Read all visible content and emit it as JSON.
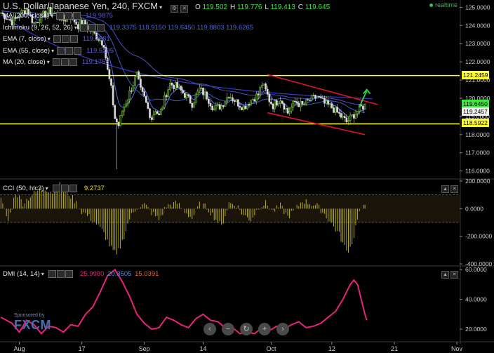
{
  "header": {
    "title": "U.S. Dollar/Japanese Yen, 240, FXCM",
    "ohlc": [
      {
        "k": "O",
        "v": "119.502"
      },
      {
        "k": "H",
        "v": "119.776"
      },
      {
        "k": "L",
        "v": "119.413"
      },
      {
        "k": "C",
        "v": "119.645"
      }
    ],
    "realtime": "realtime"
  },
  "indicators": [
    {
      "label": "MA (200, close)",
      "value": "119.9875",
      "color": "#5a5cd6"
    },
    {
      "label": "Ichimoku (9, 26, 52, 26)",
      "value": "119.3375  118.9150  119.6450  119.8803  119.6265",
      "color": "#4a6ad8"
    },
    {
      "label": "EMA (7, close)",
      "value": "119.3681",
      "color": "#5a5cd6"
    },
    {
      "label": "EMA (55, close)",
      "value": "119.5295",
      "color": "#5a5cd6"
    },
    {
      "label": "MA (20, close)",
      "value": "119.1758",
      "color": "#5a5cd6"
    }
  ],
  "cci_panel": {
    "label": "CCI (50, hlc3)",
    "value": "9.2737",
    "value_color": "#e8e020"
  },
  "dmi_panel": {
    "label": "DMI (14, 14)",
    "values": [
      "25.9980",
      "20.3505",
      "15.0391"
    ],
    "colors": [
      "#e8237a",
      "#4a8ce8",
      "#e86a23"
    ]
  },
  "sponsor": {
    "line1": "Sponsored by",
    "line2": "FXCM"
  },
  "price_tags": [
    {
      "text": "121.2459",
      "value": 121.2459,
      "bg": "#ffff30"
    },
    {
      "text": "119.6450",
      "value": 119.645,
      "bg": "#42e642"
    },
    {
      "text": "119.2457",
      "value": 119.2457,
      "bg": "#f0f0f0"
    },
    {
      "text": "118.5922",
      "value": 118.5922,
      "bg": "#ffff30"
    }
  ],
  "chart_data": [
    {
      "type": "candlestick",
      "series_name": "USD/JPY 240",
      "ylim": [
        115.6,
        125.4
      ],
      "y_ticks": [
        "125.0000",
        "124.0000",
        "123.0000",
        "122.0000",
        "121.0000",
        "120.0000",
        "119.0000",
        "118.0000",
        "117.0000",
        "116.0000"
      ],
      "y_tick_values": [
        125,
        124,
        123,
        122,
        121,
        120,
        119,
        118,
        117,
        116
      ],
      "x_ticks": [
        "Aug",
        "17",
        "Sep",
        "14",
        "Oct",
        "12",
        "21",
        "Nov"
      ],
      "x_tick_index": [
        10,
        44,
        78,
        110,
        147,
        180,
        214,
        248
      ],
      "n_bars": 250,
      "close_path": [
        [
          0,
          124.7
        ],
        [
          6,
          124.2
        ],
        [
          10,
          124.6
        ],
        [
          14,
          124.9
        ],
        [
          18,
          124.1
        ],
        [
          22,
          124.5
        ],
        [
          26,
          124.8
        ],
        [
          30,
          124.6
        ],
        [
          34,
          124.3
        ],
        [
          38,
          124.5
        ],
        [
          42,
          124.0
        ],
        [
          44,
          124.2
        ],
        [
          48,
          123.8
        ],
        [
          52,
          123.4
        ],
        [
          56,
          123.0
        ],
        [
          58,
          121.5
        ],
        [
          60,
          120.5
        ],
        [
          62,
          118.9
        ],
        [
          64,
          118.5
        ],
        [
          66,
          119.3
        ],
        [
          68,
          119.8
        ],
        [
          70,
          120.3
        ],
        [
          72,
          120.8
        ],
        [
          74,
          121.3
        ],
        [
          76,
          120.4
        ],
        [
          78,
          120.0
        ],
        [
          80,
          119.4
        ],
        [
          82,
          118.9
        ],
        [
          84,
          119.4
        ],
        [
          86,
          119.0
        ],
        [
          88,
          119.6
        ],
        [
          90,
          120.3
        ],
        [
          92,
          120.8
        ],
        [
          96,
          120.6
        ],
        [
          100,
          120.2
        ],
        [
          104,
          119.7
        ],
        [
          108,
          120.5
        ],
        [
          112,
          120.1
        ],
        [
          116,
          119.4
        ],
        [
          120,
          119.6
        ],
        [
          124,
          120.2
        ],
        [
          128,
          119.8
        ],
        [
          132,
          119.5
        ],
        [
          136,
          119.9
        ],
        [
          140,
          120.2
        ],
        [
          142,
          120.8
        ],
        [
          144,
          120.4
        ],
        [
          146,
          119.9
        ],
        [
          148,
          119.6
        ],
        [
          152,
          120.0
        ],
        [
          156,
          119.2
        ],
        [
          160,
          119.8
        ],
        [
          164,
          119.6
        ],
        [
          168,
          119.9
        ],
        [
          172,
          120.1
        ],
        [
          176,
          119.7
        ],
        [
          180,
          119.5
        ],
        [
          184,
          119.1
        ],
        [
          188,
          118.7
        ],
        [
          190,
          118.9
        ],
        [
          192,
          119.1
        ],
        [
          194,
          119.3
        ],
        [
          196,
          119.5
        ],
        [
          198,
          119.6
        ]
      ],
      "spike_low": {
        "index": 63,
        "value": 116.1
      },
      "horizontal_lines": [
        121.2459,
        118.5922
      ],
      "channel_lines": [
        {
          "from": [
            145,
            121.3
          ],
          "to": [
            205,
            119.65
          ]
        },
        {
          "from": [
            145,
            119.2
          ],
          "to": [
            198,
            118.0
          ]
        }
      ],
      "arrow": {
        "from": [
          195,
          119.5
        ],
        "to": [
          199,
          120.4
        ]
      }
    },
    {
      "type": "bar",
      "series_name": "CCI (50, hlc3)",
      "ylim": [
        -410,
        210
      ],
      "y_ticks": [
        "200.0000",
        "0.0000",
        "-200.0000",
        "-400.0000"
      ],
      "y_tick_values": [
        200,
        0,
        -200,
        -400
      ],
      "band": [
        100,
        -100
      ],
      "values_path": [
        [
          0,
          60
        ],
        [
          4,
          -90
        ],
        [
          8,
          120
        ],
        [
          12,
          40
        ],
        [
          16,
          90
        ],
        [
          20,
          130
        ],
        [
          24,
          150
        ],
        [
          28,
          120
        ],
        [
          32,
          170
        ],
        [
          36,
          120
        ],
        [
          40,
          60
        ],
        [
          44,
          -20
        ],
        [
          48,
          -60
        ],
        [
          52,
          -110
        ],
        [
          56,
          -180
        ],
        [
          60,
          -290
        ],
        [
          63,
          -340
        ],
        [
          66,
          -240
        ],
        [
          70,
          -70
        ],
        [
          74,
          10
        ],
        [
          78,
          30
        ],
        [
          82,
          -30
        ],
        [
          86,
          -80
        ],
        [
          90,
          20
        ],
        [
          96,
          40
        ],
        [
          100,
          -20
        ],
        [
          104,
          -70
        ],
        [
          108,
          30
        ],
        [
          112,
          10
        ],
        [
          116,
          -60
        ],
        [
          120,
          -130
        ],
        [
          124,
          40
        ],
        [
          128,
          30
        ],
        [
          132,
          -50
        ],
        [
          136,
          -80
        ],
        [
          140,
          10
        ],
        [
          144,
          40
        ],
        [
          148,
          -20
        ],
        [
          152,
          20
        ],
        [
          156,
          -60
        ],
        [
          160,
          -10
        ],
        [
          164,
          60
        ],
        [
          168,
          40
        ],
        [
          172,
          20
        ],
        [
          176,
          -40
        ],
        [
          180,
          -110
        ],
        [
          184,
          -190
        ],
        [
          188,
          -310
        ],
        [
          190,
          -280
        ],
        [
          192,
          -200
        ],
        [
          194,
          -60
        ],
        [
          196,
          0
        ],
        [
          198,
          10
        ]
      ]
    },
    {
      "type": "line",
      "series_name": "DMI",
      "ylim": [
        12,
        62
      ],
      "y_ticks": [
        "60.0000",
        "40.0000",
        "20.0000"
      ],
      "y_tick_values": [
        60,
        40,
        20
      ],
      "values_path": [
        [
          0,
          28
        ],
        [
          6,
          24
        ],
        [
          10,
          18
        ],
        [
          14,
          26
        ],
        [
          18,
          23
        ],
        [
          22,
          17
        ],
        [
          26,
          22
        ],
        [
          30,
          21
        ],
        [
          34,
          18
        ],
        [
          38,
          23
        ],
        [
          42,
          22
        ],
        [
          46,
          30
        ],
        [
          50,
          35
        ],
        [
          54,
          45
        ],
        [
          58,
          56
        ],
        [
          62,
          60
        ],
        [
          66,
          52
        ],
        [
          70,
          42
        ],
        [
          74,
          30
        ],
        [
          78,
          24
        ],
        [
          82,
          20
        ],
        [
          86,
          21
        ],
        [
          90,
          28
        ],
        [
          94,
          26
        ],
        [
          98,
          23
        ],
        [
          102,
          21
        ],
        [
          106,
          27
        ],
        [
          110,
          30
        ],
        [
          114,
          26
        ],
        [
          118,
          25
        ],
        [
          122,
          21
        ],
        [
          126,
          21
        ],
        [
          130,
          17
        ],
        [
          134,
          18
        ],
        [
          138,
          17
        ],
        [
          142,
          21
        ],
        [
          146,
          19
        ],
        [
          150,
          22
        ],
        [
          154,
          20
        ],
        [
          158,
          23
        ],
        [
          162,
          25
        ],
        [
          166,
          21
        ],
        [
          170,
          22
        ],
        [
          174,
          24
        ],
        [
          178,
          28
        ],
        [
          182,
          32
        ],
        [
          186,
          40
        ],
        [
          190,
          50
        ],
        [
          192,
          53
        ],
        [
          194,
          50
        ],
        [
          196,
          40
        ],
        [
          198,
          30
        ],
        [
          199,
          26
        ]
      ]
    }
  ]
}
